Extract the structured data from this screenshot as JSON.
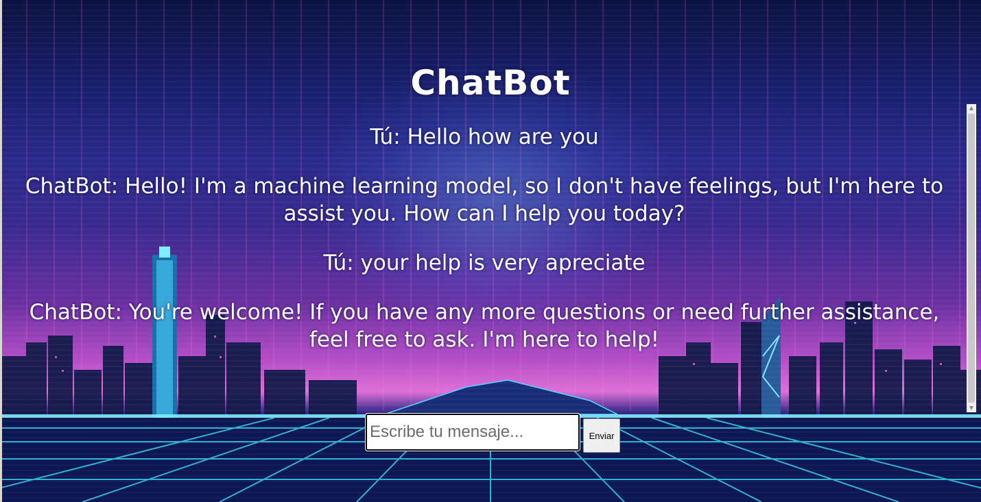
{
  "app": {
    "title": "ChatBot"
  },
  "chat": {
    "messages": [
      {
        "text": "Tú: Hello how are you"
      },
      {
        "text": "ChatBot: Hello! I'm a machine learning model, so I don't have feelings, but I'm here to assist you. How can I help you today?"
      },
      {
        "text": "Tú: your help is very apreciate"
      },
      {
        "text": "ChatBot: You're welcome! If you have any more questions or need further assistance, feel free to ask. I'm here to help!"
      }
    ]
  },
  "composer": {
    "placeholder": "Escribe tu mensaje...",
    "value": "",
    "send_label": "Enviar"
  },
  "colors": {
    "text": "#ffffff",
    "sky_top": "#0c1240",
    "horizon_pink": "#e070d8",
    "neon_cyan": "#3fe6ff",
    "neon_magenta": "#ff5ad0"
  }
}
